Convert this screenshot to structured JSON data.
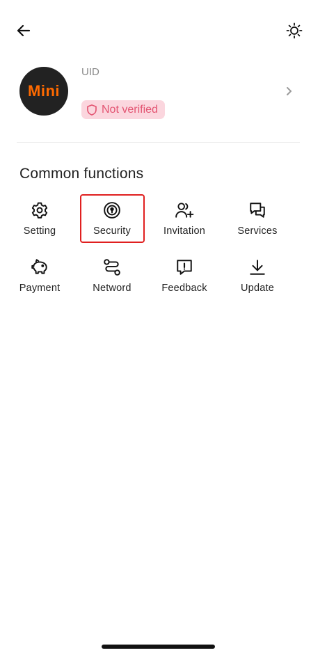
{
  "header": {
    "back_icon": "arrow-left-icon",
    "theme_icon": "sun-icon"
  },
  "profile": {
    "avatar_text": "Mini",
    "uid_label": "UID",
    "status_badge": "Not verified",
    "badge_icon": "shield-icon",
    "chevron_icon": "chevron-right-icon"
  },
  "functions": {
    "title": "Common functions",
    "items": [
      {
        "label": "Setting",
        "icon": "gear-icon"
      },
      {
        "label": "Security",
        "icon": "lock-icon"
      },
      {
        "label": "Invitation",
        "icon": "add-user-icon"
      },
      {
        "label": "Services",
        "icon": "chat-icon"
      },
      {
        "label": "Payment",
        "icon": "piggy-bank-icon"
      },
      {
        "label": "Netword",
        "icon": "route-icon"
      },
      {
        "label": "Feedback",
        "icon": "feedback-icon"
      },
      {
        "label": "Update",
        "icon": "download-icon"
      }
    ]
  },
  "colors": {
    "accent_orange": "#ff6a00",
    "badge_bg": "#fbd6de",
    "badge_text": "#e35472",
    "highlight_red": "#e01f1f"
  }
}
